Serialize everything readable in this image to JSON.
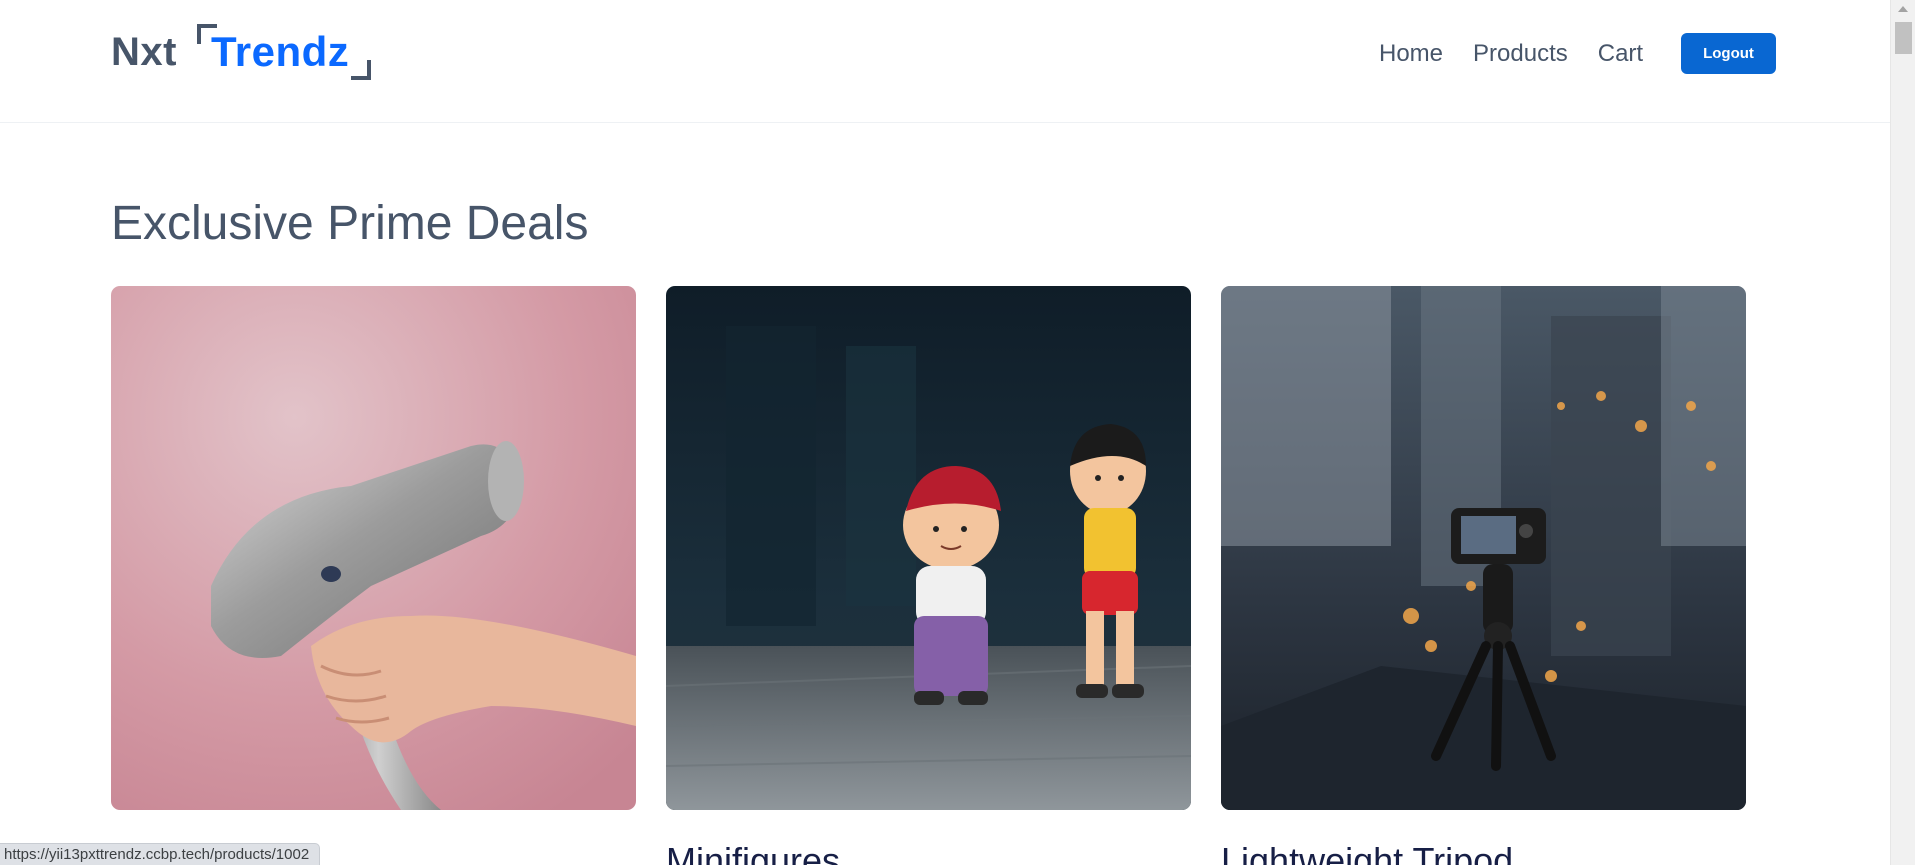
{
  "header": {
    "logo_part1": "Nxt",
    "logo_part2": "Trendz",
    "nav": [
      {
        "label": "Home"
      },
      {
        "label": "Products"
      },
      {
        "label": "Cart"
      }
    ],
    "logout_label": "Logout"
  },
  "main": {
    "section_title": "Exclusive Prime Deals",
    "deals": [
      {
        "name": "",
        "image": "hair-dryer-image"
      },
      {
        "name": "Minifigures",
        "image": "minifigures-image"
      },
      {
        "name": "Lightweight Tripod",
        "image": "tripod-camera-image"
      }
    ]
  },
  "status_bar": {
    "url": "https://yii13pxttrendz.ccbp.tech/products/1002"
  },
  "colors": {
    "brand_blue": "#0b69ff",
    "logout_bg": "#0967d2",
    "heading": "#475569"
  }
}
